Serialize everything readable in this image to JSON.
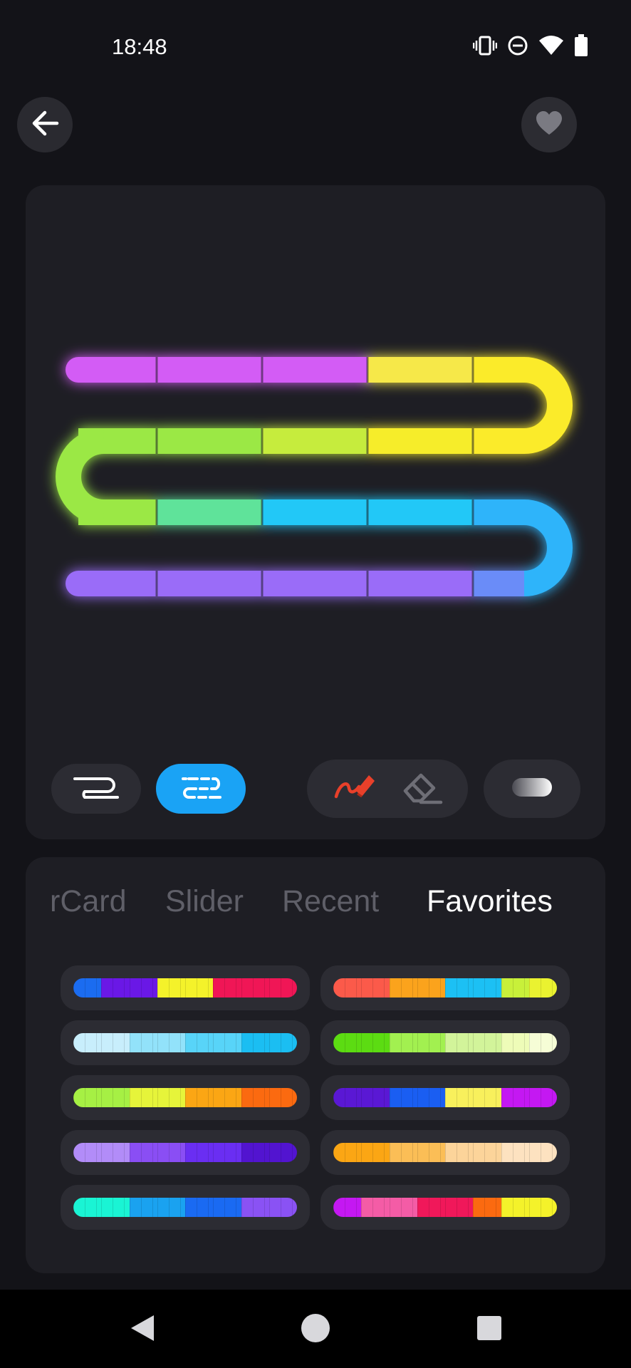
{
  "status_bar": {
    "time": "18:48",
    "icons": [
      "vibrate-icon",
      "do-not-disturb-icon",
      "wifi-icon",
      "battery-icon"
    ]
  },
  "top_bar": {
    "back_icon": "arrow-left-icon",
    "favorite_icon": "heart-icon"
  },
  "preview": {
    "strip_rows": [
      {
        "colors": [
          "#d35cf5",
          "#d35cf5",
          "#d35cf5",
          "#f6e84a",
          "#fbeb2a"
        ]
      },
      {
        "colors": [
          "#9be845",
          "#9be845",
          "#c6ec3c",
          "#f6ed2c",
          "#fbeb2a"
        ]
      },
      {
        "colors": [
          "#9be845",
          "#5fe39a",
          "#22c8f7",
          "#22c8f7",
          "#2fb4fa"
        ]
      },
      {
        "colors": [
          "#9a6cf8",
          "#9a6cf8",
          "#9a6cf8",
          "#9a6cf8",
          "#6a8cf8"
        ]
      }
    ],
    "tools": {
      "mode_serpentine": "serpentine-icon",
      "mode_segment": "segment-icon",
      "paint": "brush-icon",
      "erase": "eraser-icon",
      "toggle": "gradient-toggle-icon"
    }
  },
  "palette": {
    "tabs": [
      {
        "label": "rCard",
        "active": false
      },
      {
        "label": "Slider",
        "active": false
      },
      {
        "label": "Recent",
        "active": false
      },
      {
        "label": "Favorites",
        "active": true
      }
    ],
    "swatches": [
      [
        "#1b6cf0",
        "#6a18e6",
        "#6a18e6",
        "#f4f22a",
        "#f4f22a",
        "#f01656",
        "#f01656",
        "#f01656"
      ],
      [
        "#fb5a4a",
        "#fb5a4a",
        "#fba31c",
        "#fba31c",
        "#1cc0f4",
        "#1cc0f4",
        "#c8f03a",
        "#eaf230"
      ],
      [
        "#c8eefc",
        "#c8eefc",
        "#92e2fa",
        "#92e2fa",
        "#58d4f8",
        "#58d4f8",
        "#1bbef2",
        "#1bbef2"
      ],
      [
        "#5cdc12",
        "#5cdc12",
        "#a2f050",
        "#a2f050",
        "#d2f49a",
        "#d2f49a",
        "#eefcb8",
        "#f6fdd6"
      ],
      [
        "#a6f044",
        "#a6f044",
        "#e6f43a",
        "#e6f43a",
        "#fba614",
        "#fba614",
        "#fb6a10",
        "#fb6a10"
      ],
      [
        "#5a18d4",
        "#5a18d4",
        "#1a5ef2",
        "#1a5ef2",
        "#f8f05c",
        "#f8f05c",
        "#c418f2",
        "#c418f2"
      ],
      [
        "#b28cf8",
        "#b28cf8",
        "#8a4ef4",
        "#8a4ef4",
        "#6a2ef2",
        "#6a2ef2",
        "#5214d0",
        "#5214d0"
      ],
      [
        "#fba614",
        "#fba614",
        "#fbbe56",
        "#fbbe56",
        "#fcd49a",
        "#fcd49a",
        "#fde2c0",
        "#fde2c0"
      ],
      [
        "#1af4d4",
        "#1af4d4",
        "#1aa2f0",
        "#1aa2f0",
        "#1a6af2",
        "#1a6af2",
        "#8a52f4",
        "#8a52f4"
      ],
      [
        "#c418f2",
        "#f45ca6",
        "#f45ca6",
        "#f0185a",
        "#f0185a",
        "#fb6a10",
        "#f4f22a",
        "#f4f22a"
      ]
    ]
  },
  "nav": {
    "back_icon": "nav-back-icon",
    "home_icon": "nav-home-icon",
    "recents_icon": "nav-recents-icon"
  }
}
